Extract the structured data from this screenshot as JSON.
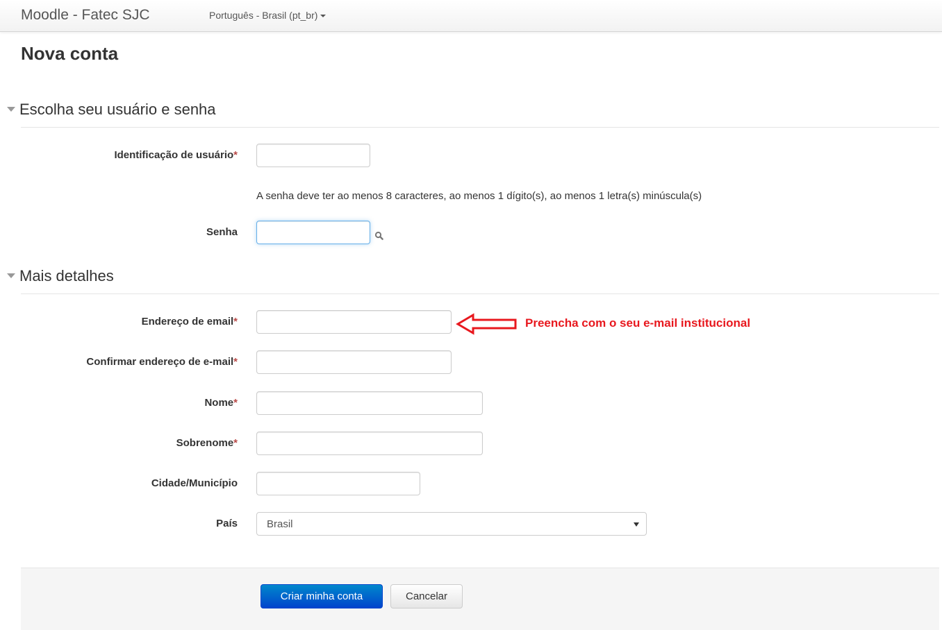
{
  "navbar": {
    "brand": "Moodle - Fatec SJC",
    "language": "Português - Brasil (pt_br)"
  },
  "page_title": "Nova conta",
  "section_credentials": {
    "legend": "Escolha seu usuário e senha",
    "username_label": "Identificação de usuário",
    "username_value": "",
    "password_hint": "A senha deve ter ao menos 8 caracteres, ao menos 1 dígito(s), ao menos 1 letra(s) minúscula(s)",
    "password_label": "Senha",
    "password_value": "",
    "reveal_icon": "magnifier-icon"
  },
  "section_details": {
    "legend": "Mais detalhes",
    "email_label": "Endereço de email",
    "email_value": "",
    "email_confirm_label": "Confirmar endereço de e-mail",
    "email_confirm_value": "",
    "firstname_label": "Nome",
    "firstname_value": "",
    "lastname_label": "Sobrenome",
    "lastname_value": "",
    "city_label": "Cidade/Município",
    "city_value": "",
    "country_label": "País",
    "country_value": "Brasil"
  },
  "annotation": {
    "text": "Preencha com o seu e-mail institucional",
    "color": "#e8181e"
  },
  "required_marker": "*",
  "buttons": {
    "submit": "Criar minha conta",
    "cancel": "Cancelar"
  }
}
